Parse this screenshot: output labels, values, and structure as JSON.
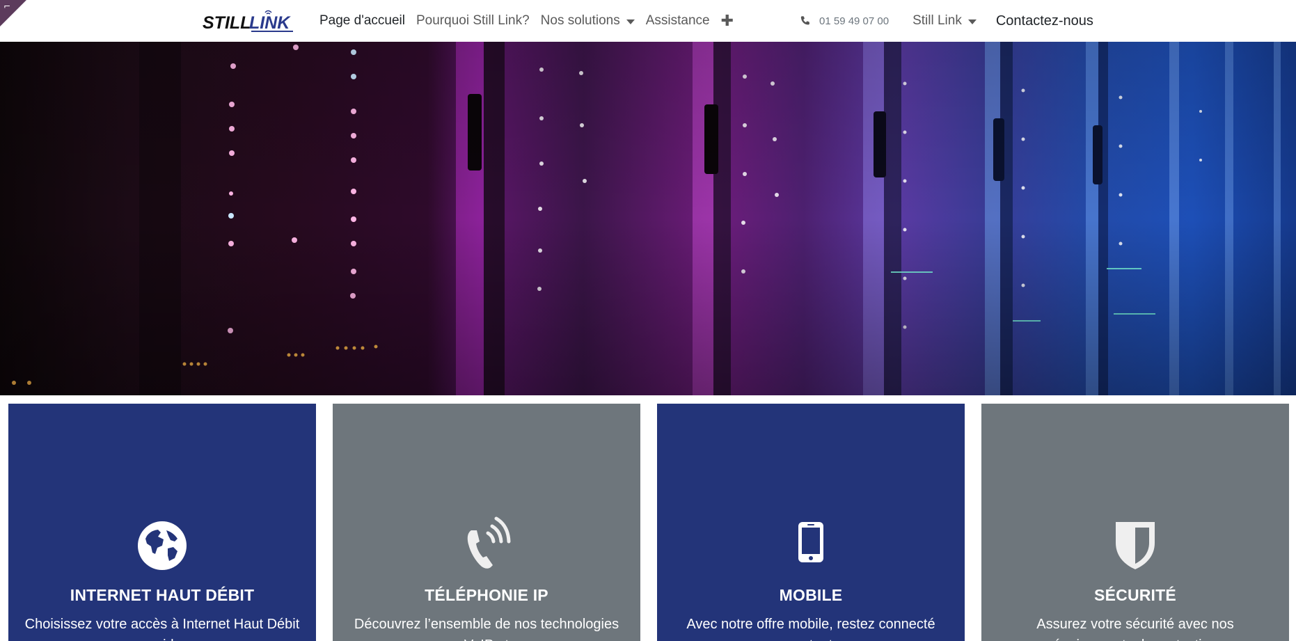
{
  "header": {
    "logo_text": "STILL LINK",
    "nav": [
      {
        "label": "Page d'accueil",
        "active": true,
        "dropdown": false
      },
      {
        "label": "Pourquoi Still Link?",
        "active": false,
        "dropdown": false
      },
      {
        "label": "Nos solutions",
        "active": false,
        "dropdown": true
      },
      {
        "label": "Assistance",
        "active": false,
        "dropdown": false
      }
    ],
    "plus_symbol": "✚",
    "phone": "01 59 49 07 00",
    "company_menu": "Still Link",
    "contact": "Contactez-nous"
  },
  "cards": [
    {
      "title": "INTERNET HAUT DÉBIT",
      "text": "Choisissez votre accès à Internet Haut Débit rapide",
      "icon": "globe-icon",
      "color": "#233479"
    },
    {
      "title": "TÉLÉPHONIE IP",
      "text": "Découvrez l’ensemble de nos technologies VoIP et",
      "icon": "phone-ringing-icon",
      "color": "#6e767c"
    },
    {
      "title": "MOBILE",
      "text": "Avec notre offre mobile, restez connecté partout",
      "icon": "mobile-phone-icon",
      "color": "#233479"
    },
    {
      "title": "SÉCURITÉ",
      "text": "Assurez votre sécurité avec nos équipements de protection",
      "icon": "shield-icon",
      "color": "#6e767c"
    }
  ],
  "colors": {
    "brand_blue": "#233479",
    "gray": "#6e767c",
    "corner_badge": "#5c3b5c"
  }
}
